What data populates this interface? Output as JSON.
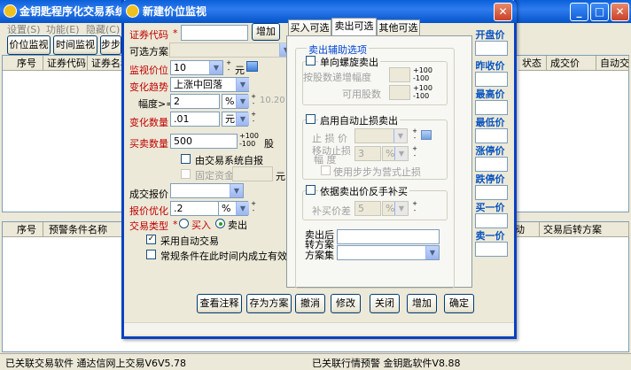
{
  "main_window": {
    "title": "金钥匙程序化交易系统",
    "menu": [
      "设置(S)",
      "功能(E)",
      "隐藏(C)"
    ],
    "toolbar": [
      "价位监视",
      "时间监视",
      "步步"
    ],
    "table1_headers": [
      "序号",
      "证券代码",
      "证券名称"
    ],
    "table1_right_headers": [
      "状态",
      "成交价",
      "自动交"
    ],
    "table2_headers": [
      "序号",
      "预警条件名称"
    ],
    "table2_right_headers": [
      "动",
      "交易后转方案"
    ],
    "status_left": "已关联交易软件 通达信网上交易V6V5.78",
    "status_right": "已关联行情预警 金钥匙软件V8.88"
  },
  "dialog": {
    "title": "新建价位监视",
    "stock_code_label": "证券代码",
    "stock_code_value": "",
    "add_button": "增加",
    "optional_scheme_label": "可选方案",
    "monitor_price_label": "监视价位",
    "monitor_price_value": "10",
    "unit_yuan": "元",
    "trend_label": "变化趋势",
    "trend_value": "上涨中回落",
    "amplitude_label": "幅度>=",
    "amplitude_value": "2",
    "amplitude_unit": "%",
    "amplitude_range": "10.20",
    "change_qty_label": "变化数量",
    "change_qty_value": ".01",
    "buy_qty_label": "买卖数量",
    "buy_qty_value": "500",
    "spin_plus": "+100",
    "spin_minus": "-100",
    "unit_share": "股",
    "auto_system_label": "由交易系统自报",
    "fixed_capital_label": "固定资金",
    "fixed_unit": "元",
    "deal_price_label": "成交报价",
    "price_opt_label": "报价优化",
    "price_opt_value": ".2",
    "price_opt_unit": "%",
    "trade_type_label": "交易类型",
    "buy_label": "买入",
    "sell_label": "卖出",
    "use_auto_trade": "采用自动交易",
    "valid_in_time": "常规条件在此时间内成立有效",
    "tabs": [
      "买入可选",
      "卖出可选",
      "其他可选"
    ],
    "sell_aux_title": "卖出辅助选项",
    "single_spiral": "单向螺旋卖出",
    "inc_amp_label": "按股数递增幅度",
    "avail_shares_label": "可用股数",
    "enable_stop_loss": "启用自动止损卖出",
    "stop_price_label": "止 损 价",
    "move_stop_label1": "移动止损",
    "move_stop_label2": "幅 度",
    "move_stop_value": "3",
    "move_stop_unit": "%",
    "use_step_label": "使用步步为营式止损",
    "reverse_buy": "依据卖出价反手补买",
    "rebuy_price_label": "补买价差",
    "rebuy_value": "5",
    "rebuy_unit": "%",
    "after_sell_label1": "卖出后",
    "after_sell_label2": "转方案",
    "scheme_set_label": "方案集",
    "buttons": [
      "查看注释",
      "存为方案",
      "撤消",
      "修改",
      "关闭",
      "增加",
      "确定"
    ]
  },
  "side_prices": [
    "开盘价",
    "昨收价",
    "最高价",
    "最低价",
    "涨停价",
    "跌停价",
    "买一价",
    "卖一价"
  ]
}
